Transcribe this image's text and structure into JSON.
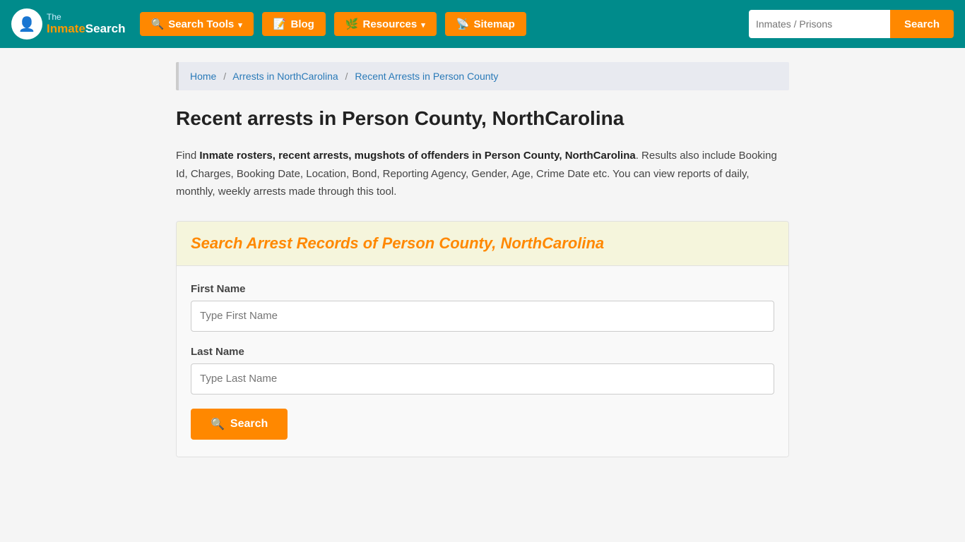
{
  "header": {
    "logo_line1": "The",
    "logo_line2": "Inmate",
    "logo_line3": "Search",
    "nav_items": [
      {
        "id": "search-tools",
        "label": "Search Tools",
        "icon": "🔍",
        "has_dropdown": true
      },
      {
        "id": "blog",
        "label": "Blog",
        "icon": "📝",
        "has_dropdown": false
      },
      {
        "id": "resources",
        "label": "Resources",
        "icon": "🌿",
        "has_dropdown": true
      },
      {
        "id": "sitemap",
        "label": "Sitemap",
        "icon": "📡",
        "has_dropdown": false
      }
    ],
    "search_placeholder": "Inmates / Prisons",
    "search_btn_label": "Search"
  },
  "breadcrumb": {
    "home_label": "Home",
    "arrests_nc_label": "Arrests in NorthCarolina",
    "current_label": "Recent Arrests in Person County"
  },
  "page": {
    "title": "Recent arrests in Person County, NorthCarolina",
    "description_bold": "Inmate rosters, recent arrests, mugshots of offenders in Person County, NorthCarolina",
    "description_rest": ". Results also include Booking Id, Charges, Booking Date, Location, Bond, Reporting Agency, Gender, Age, Crime Date etc. You can view reports of daily, monthly, weekly arrests made through this tool.",
    "find_prefix": "Find "
  },
  "search_form": {
    "section_title": "Search Arrest Records of Person County, NorthCarolina",
    "first_name_label": "First Name",
    "first_name_placeholder": "Type First Name",
    "last_name_label": "Last Name",
    "last_name_placeholder": "Type Last Name",
    "submit_label": "Search"
  }
}
